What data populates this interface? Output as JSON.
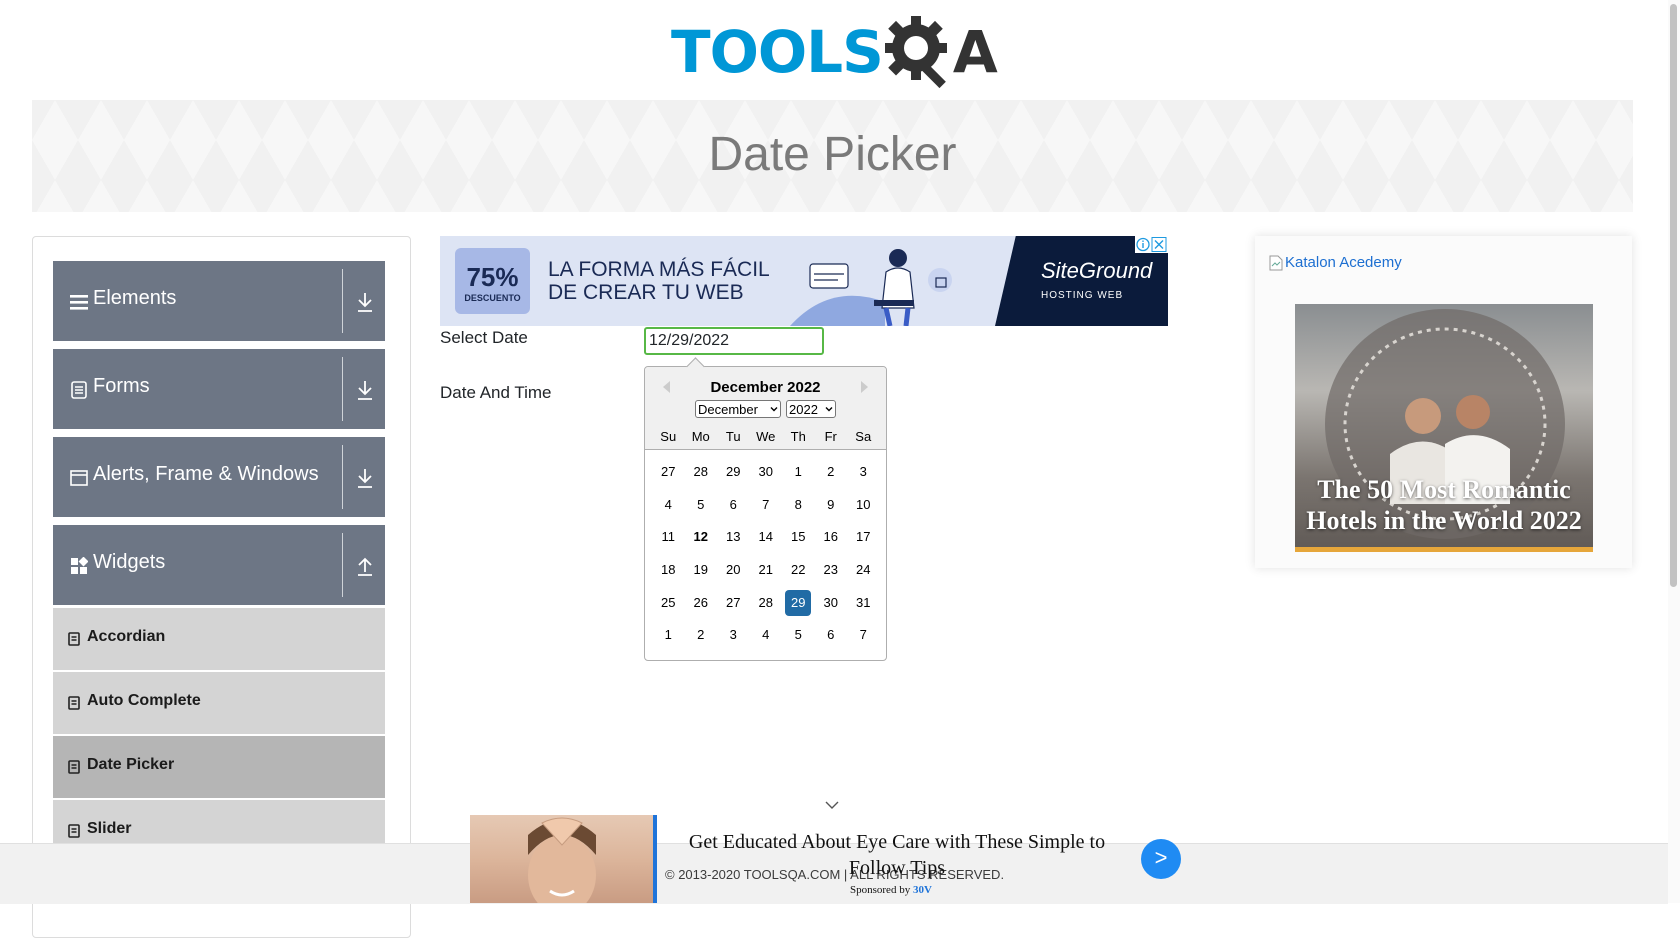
{
  "header": {
    "logo_text_left": "TOOLS",
    "logo_text_right": "A",
    "page_title": "Date Picker"
  },
  "sidebar": {
    "groups": [
      {
        "label": "Elements",
        "icon": "menu-icon"
      },
      {
        "label": "Forms",
        "icon": "document-icon"
      },
      {
        "label": "Alerts, Frame & Windows",
        "icon": "window-icon"
      },
      {
        "label": "Widgets",
        "icon": "widgets-icon"
      }
    ],
    "items": [
      {
        "label": "Accordian"
      },
      {
        "label": "Auto Complete"
      },
      {
        "label": "Date Picker",
        "active": true
      },
      {
        "label": "Slider"
      }
    ]
  },
  "ad_top": {
    "percent": "75%",
    "percent_caption": "DESCUENTO",
    "headline_line1": "LA FORMA MÁS FÁCIL",
    "headline_line2": "DE CREAR TU WEB",
    "brand": "SiteGround",
    "brand_sub": "HOSTING WEB"
  },
  "form": {
    "select_date_label": "Select Date",
    "select_date_value": "12/29/2022",
    "date_time_label": "Date And Time"
  },
  "calendar": {
    "title": "December 2022",
    "month_select": "December",
    "year_select": "2022",
    "day_names": [
      "Su",
      "Mo",
      "Tu",
      "We",
      "Th",
      "Fr",
      "Sa"
    ],
    "weeks": [
      [
        "27",
        "28",
        "29",
        "30",
        "1",
        "2",
        "3"
      ],
      [
        "4",
        "5",
        "6",
        "7",
        "8",
        "9",
        "10"
      ],
      [
        "11",
        "12",
        "13",
        "14",
        "15",
        "16",
        "17"
      ],
      [
        "18",
        "19",
        "20",
        "21",
        "22",
        "23",
        "24"
      ],
      [
        "25",
        "26",
        "27",
        "28",
        "29",
        "30",
        "31"
      ],
      [
        "1",
        "2",
        "3",
        "4",
        "5",
        "6",
        "7"
      ]
    ],
    "today": "12",
    "selected": "29",
    "accent_color": "#216ba5"
  },
  "right_ad": {
    "broken_image_alt": "Katalon Acedemy",
    "caption_line1": "The 50 Most Romantic",
    "caption_line2": "Hotels in the World 2022"
  },
  "bottom_ad": {
    "title": "Get Educated About Eye Care with These Simple to Follow Tips",
    "sponsored_by": "Sponsored by",
    "sponsor_name": "30V",
    "go_label": ">"
  },
  "footer": {
    "copyright": "© 2013-2020 TOOLSQA.COM | ALL RIGHTS RESERVED."
  }
}
